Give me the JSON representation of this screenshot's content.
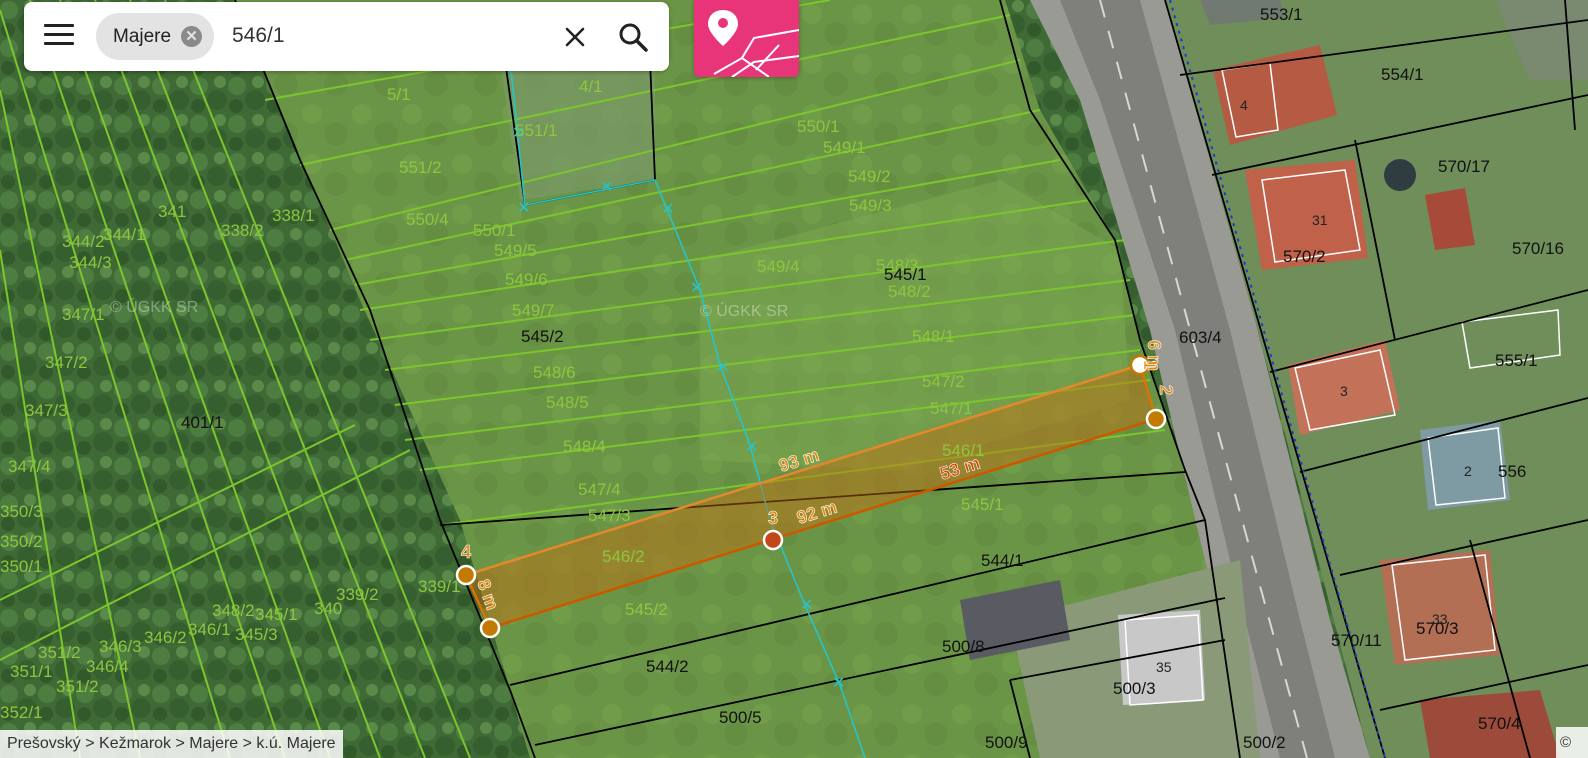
{
  "search": {
    "chip_label": "Majere",
    "query": "546/1",
    "chip_close_glyph": "✕",
    "clear_glyph": "✕"
  },
  "breadcrumb": "Prešovský > Kežmarok > Majere > k.ú. Majere",
  "copyright": "©",
  "watermark": "© ÚGKK SR",
  "parcels_green": [
    "5/1",
    "4/1",
    "551/1",
    "551/2",
    "550/4",
    "550/1",
    "549/5",
    "549/6",
    "549/7",
    "550/1",
    "549/1",
    "549/2",
    "549/3",
    "549/4",
    "548/3",
    "548/2",
    "548/1",
    "548/6",
    "548/5",
    "548/4",
    "547/2",
    "547/1",
    "547/4",
    "547/3",
    "546/1",
    "546/2",
    "545/2",
    "545/1",
    "341",
    "338/2",
    "338/1",
    "344/1",
    "344/2",
    "344/3",
    "347/1",
    "347/2",
    "347/3",
    "347/4",
    "350/3",
    "350/2",
    "350/1",
    "348/2",
    "345/1",
    "345/3",
    "346/1",
    "346/2",
    "346/3",
    "346/4",
    "351/2",
    "351/1",
    "351/2",
    "352/1",
    "340",
    "339/2",
    "339/1"
  ],
  "parcels_black": [
    "545/1",
    "545/2",
    "401/1",
    "603/4",
    "544/1",
    "544/2",
    "500/8",
    "500/5",
    "500/3",
    "500/9",
    "500/2",
    "553/1",
    "554/1",
    "570/17",
    "570/2",
    "570/16",
    "555/1",
    "556",
    "570/11",
    "570/3",
    "570/4"
  ],
  "house_numbers": [
    "4",
    "31",
    "3",
    "2",
    "33",
    "35"
  ],
  "measurements": {
    "vertex_labels": [
      "1",
      "2",
      "3",
      "4"
    ],
    "lengths": [
      "93 m",
      "92 m",
      "53 m",
      "8 m",
      "6 m"
    ]
  },
  "colors": {
    "accent": "#e8357a",
    "parcel_line": "#7bc62d",
    "measure": "#d96d00",
    "route": "#27c4c7"
  }
}
